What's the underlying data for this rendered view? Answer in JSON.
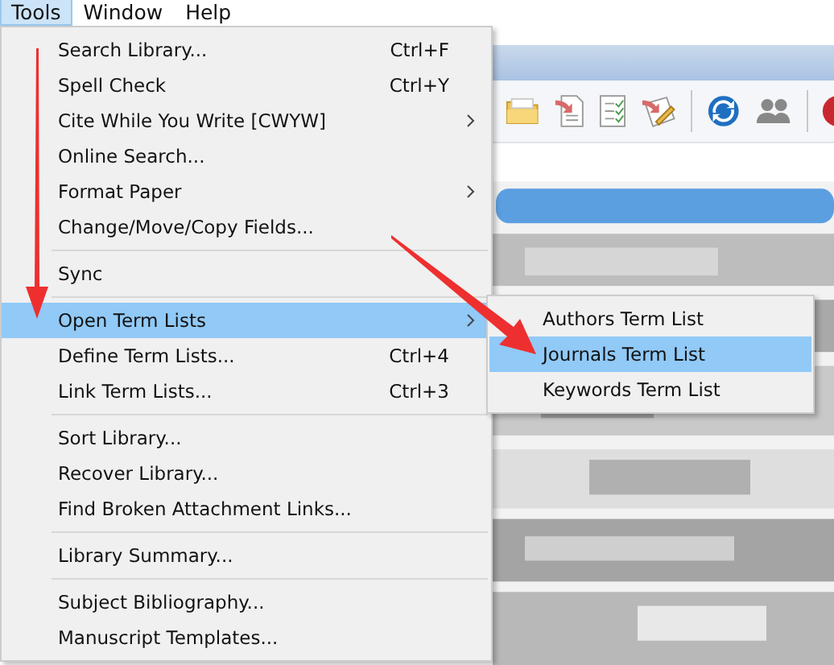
{
  "menubar": [
    {
      "label": "Tools",
      "selected": true
    },
    {
      "label": "Window",
      "selected": false
    },
    {
      "label": "Help",
      "selected": false
    }
  ],
  "menu": {
    "items": [
      {
        "kind": "item",
        "label": "Search Library...",
        "shortcut": "Ctrl+F",
        "submenu": false,
        "selected": false
      },
      {
        "kind": "item",
        "label": "Spell Check",
        "shortcut": "Ctrl+Y",
        "submenu": false,
        "selected": false
      },
      {
        "kind": "item",
        "label": "Cite While You Write [CWYW]",
        "submenu": true,
        "selected": false
      },
      {
        "kind": "item",
        "label": "Online Search...",
        "submenu": false,
        "selected": false
      },
      {
        "kind": "item",
        "label": "Format Paper",
        "submenu": true,
        "selected": false
      },
      {
        "kind": "item",
        "label": "Change/Move/Copy Fields...",
        "submenu": false,
        "selected": false
      },
      {
        "kind": "separator"
      },
      {
        "kind": "item",
        "label": "Sync",
        "submenu": false,
        "selected": false
      },
      {
        "kind": "separator"
      },
      {
        "kind": "item",
        "label": "Open Term Lists",
        "submenu": true,
        "selected": true
      },
      {
        "kind": "item",
        "label": "Define Term Lists...",
        "shortcut": "Ctrl+4",
        "submenu": false,
        "selected": false
      },
      {
        "kind": "item",
        "label": "Link Term Lists...",
        "shortcut": "Ctrl+3",
        "submenu": false,
        "selected": false
      },
      {
        "kind": "separator"
      },
      {
        "kind": "item",
        "label": "Sort Library...",
        "submenu": false,
        "selected": false
      },
      {
        "kind": "item",
        "label": "Recover Library...",
        "submenu": false,
        "selected": false
      },
      {
        "kind": "item",
        "label": "Find Broken Attachment Links...",
        "submenu": false,
        "selected": false
      },
      {
        "kind": "separator"
      },
      {
        "kind": "item",
        "label": "Library Summary...",
        "submenu": false,
        "selected": false
      },
      {
        "kind": "separator"
      },
      {
        "kind": "item",
        "label": "Subject Bibliography...",
        "submenu": false,
        "selected": false
      },
      {
        "kind": "item",
        "label": "Manuscript Templates...",
        "submenu": false,
        "selected": false
      }
    ]
  },
  "submenu": {
    "items": [
      {
        "label": "Authors Term List",
        "selected": false
      },
      {
        "label": "Journals Term List",
        "selected": true
      },
      {
        "label": "Keywords Term List",
        "selected": false
      }
    ]
  }
}
